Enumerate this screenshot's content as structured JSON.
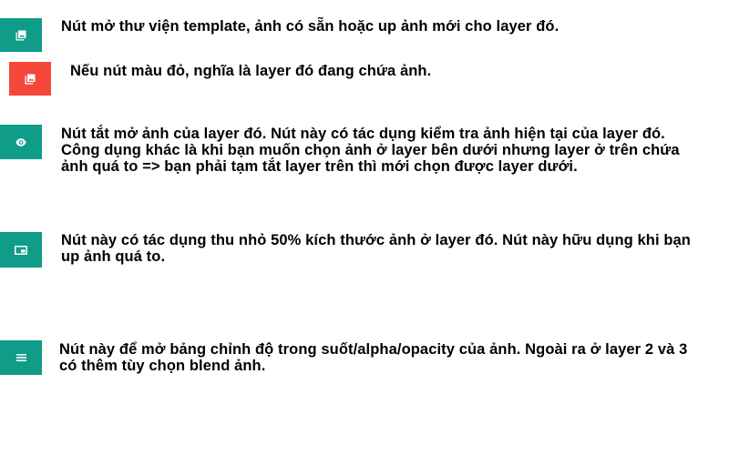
{
  "colors": {
    "teal": "#0f9c89",
    "red": "#f4473a",
    "icon": "#ffffff",
    "text": "#000000"
  },
  "rows": [
    {
      "icon": "photo-library-icon",
      "button_color": "teal",
      "text": "Nút mở thư viện template, ảnh có sẵn hoặc up ảnh mới cho layer đó."
    },
    {
      "icon": "photo-library-icon",
      "button_color": "red",
      "text": "Nếu nút màu đỏ, nghĩa là layer đó đang chứa ảnh."
    },
    {
      "icon": "eye-icon",
      "button_color": "teal",
      "text": "Nút tắt mở ảnh của layer đó. Nút này có tác dụng kiểm tra ảnh hiện tại của layer đó. Công dụng khác là khi bạn muốn chọn ảnh ở layer bên dưới nhưng layer ở trên chứa ảnh quá to => bạn phải tạm tắt layer trên thì mới chọn được layer dưới."
    },
    {
      "icon": "picture-in-picture-icon",
      "button_color": "teal",
      "text": "Nút này có tác dụng thu nhỏ 50% kích thước ảnh ở layer đó. Nút này hữu dụng khi bạn up ảnh quá to."
    },
    {
      "icon": "menu-icon",
      "button_color": "teal",
      "text": "Nút này để mở bảng chỉnh độ trong suốt/alpha/opacity của ảnh. Ngoài ra ở layer 2 và 3 có thêm tùy chọn blend ảnh."
    }
  ]
}
